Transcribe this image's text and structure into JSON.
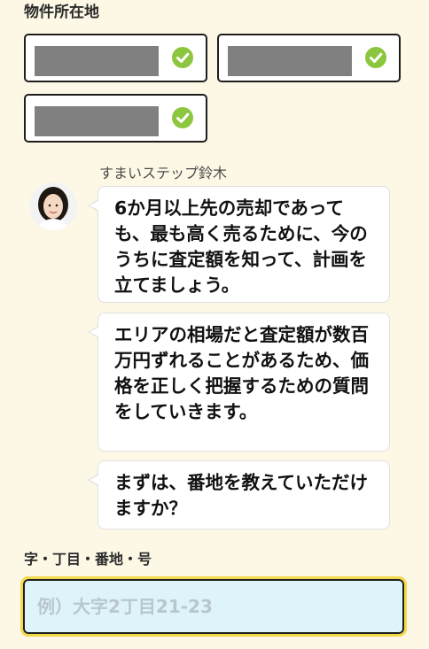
{
  "property_location": {
    "title": "物件所在地",
    "selections": [
      {
        "redacted": true,
        "status": "selected",
        "icon": "check-circle-icon"
      },
      {
        "redacted": true,
        "status": "selected",
        "icon": "check-circle-icon"
      },
      {
        "redacted": true,
        "status": "selected",
        "icon": "check-circle-icon"
      }
    ]
  },
  "chat": {
    "agent_name": "すまいステップ鈴木",
    "avatar_icon": "agent-avatar",
    "messages": [
      "6か月以上先の売却であっても、最も高く売るために、今のうちに査定額を知って、計画を立てましょう。",
      "エリアの相場だと査定額が数百万円ずれることがあるため、価格を正しく把握するための質問をしていきます。",
      "まずは、番地を教えていただけますか？"
    ]
  },
  "address_field": {
    "label": "字・丁目・番地・号",
    "placeholder": "例）大字2丁目21-23",
    "value": ""
  },
  "colors": {
    "background": "#fdf8e6",
    "check": "#8cc63f",
    "input_background": "#dff3fb",
    "focus_outline": "#f2d94a"
  }
}
